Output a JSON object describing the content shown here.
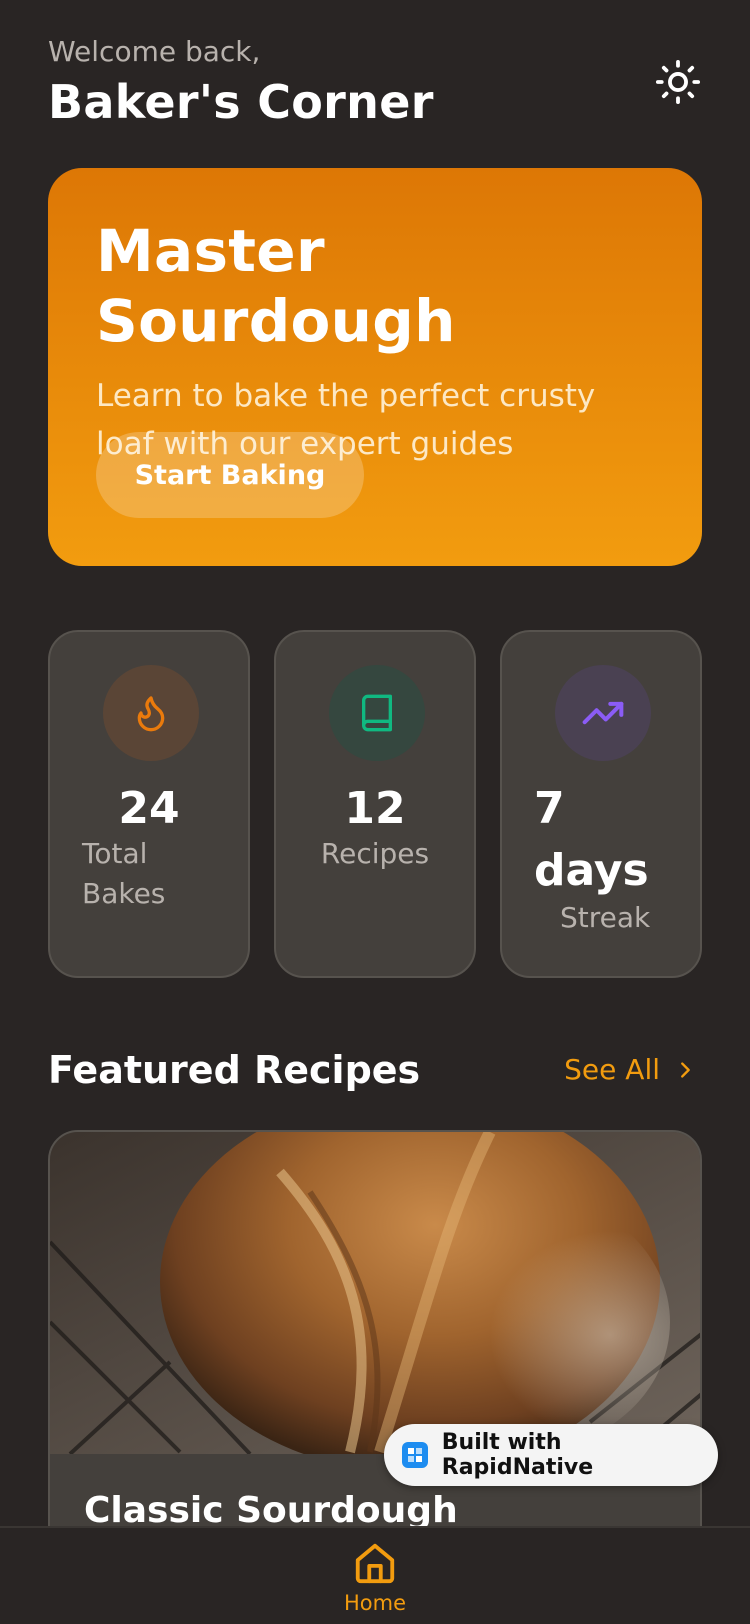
{
  "header": {
    "welcome": "Welcome back,",
    "title": "Baker's Corner",
    "theme_icon": "sun-icon"
  },
  "hero": {
    "title": "Master Sourdough",
    "subtitle": "Learn to bake the perfect crusty loaf with our expert guides",
    "button_label": "Start Baking",
    "gradient_top": "#dd7705",
    "gradient_bottom": "#f29c0f"
  },
  "stats": [
    {
      "icon": "flame-icon",
      "value": "24",
      "label": "Total Bakes",
      "icon_color": "#ea7a0c",
      "icon_bg": "#5a4536"
    },
    {
      "icon": "book-icon",
      "value": "12",
      "label": "Recipes",
      "icon_color": "#10b981",
      "icon_bg": "#35473f"
    },
    {
      "icon": "trending-up-icon",
      "value": "7 days",
      "label": "Streak",
      "icon_color": "#8b5cf6",
      "icon_bg": "#4a4152"
    }
  ],
  "featured": {
    "title": "Featured Recipes",
    "see_all": "See All",
    "recipes": [
      {
        "title": "Classic Sourdough"
      }
    ]
  },
  "badge": {
    "text": "Built with RapidNative"
  },
  "tabbar": {
    "home_label": "Home",
    "accent": "#f29c0f"
  }
}
